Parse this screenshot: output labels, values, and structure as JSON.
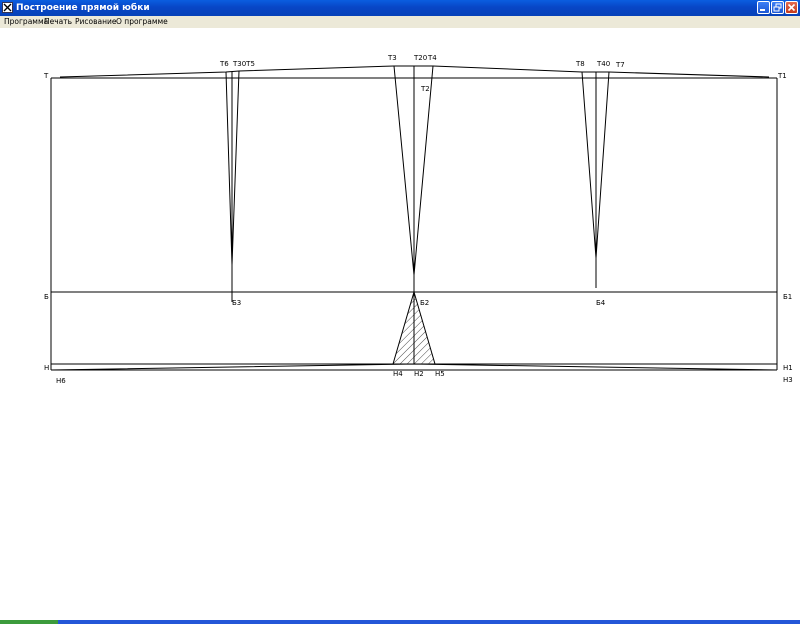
{
  "window": {
    "title": "Построение прямой юбки",
    "icon": "app-x-icon",
    "controls": [
      "minimize-icon",
      "restore-icon",
      "close-icon"
    ]
  },
  "menu": {
    "items": [
      {
        "label": "Программа"
      },
      {
        "label": "Печать"
      },
      {
        "label": "Рисование"
      },
      {
        "label": "О программе"
      }
    ]
  },
  "drawing": {
    "point_labels": {
      "T": "Т",
      "T1": "Т1",
      "T2": "Т2",
      "T3": "Т3",
      "T20": "Т20",
      "T4": "Т4",
      "T6": "Т6",
      "T30T5": "Т30Т5",
      "T8": "Т8",
      "T40": "Т40",
      "T7": "Т7",
      "B": "Б",
      "B1": "Б1",
      "B2": "Б2",
      "B3": "Б3",
      "B4": "Б4",
      "H": "Н",
      "H1": "Н1",
      "H2": "Н2",
      "H3": "Н3",
      "H4": "Н4",
      "H5": "Н5",
      "H6": "Н6"
    }
  },
  "colors": {
    "titlebar": "#0846c6",
    "menubar": "#ece9d8",
    "canvas": "#ffffff",
    "line": "#000000"
  }
}
